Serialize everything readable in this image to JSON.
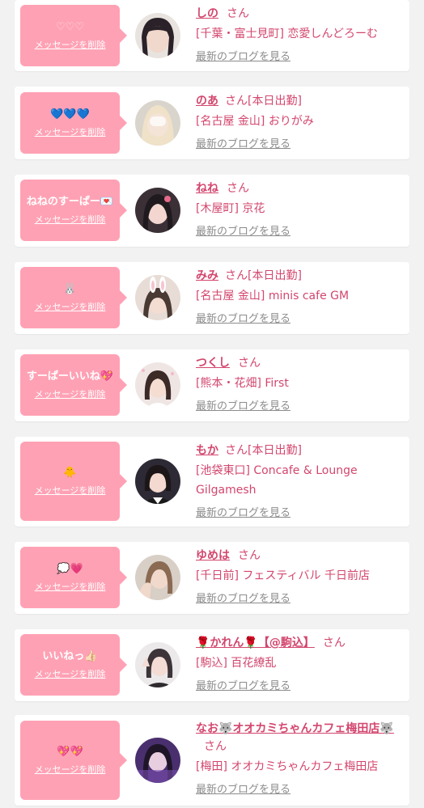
{
  "labels": {
    "delete": "メッセージを削除",
    "blog": "最新のブログを見る",
    "san": "さん"
  },
  "cards": [
    {
      "message": "♡♡♡",
      "name": "しの",
      "status": "",
      "shop": "[千葉・富士見町] 恋愛しんどろーむ",
      "avatar_icon": "profile-photo"
    },
    {
      "message": "💙💙💙",
      "name": "のあ",
      "status": "[本日出勤]",
      "shop": "[名古屋 金山] おりがみ",
      "avatar_icon": "profile-photo"
    },
    {
      "message": "ねねのすーぱー💌",
      "name": "ねね",
      "status": "",
      "shop": "[木屋町] 京花",
      "avatar_icon": "profile-photo"
    },
    {
      "message": "🐰",
      "name": "みみ",
      "status": "[本日出勤]",
      "shop": "[名古屋 金山] minis cafe GM",
      "avatar_icon": "profile-photo"
    },
    {
      "message": "すーぱーいいね💖",
      "name": "つくし",
      "status": "",
      "shop": "[熊本・花畑] First",
      "avatar_icon": "profile-photo"
    },
    {
      "message": "🐥",
      "name": "もか",
      "status": "[本日出勤]",
      "shop": "[池袋東口] Concafe & Lounge Gilgamesh",
      "avatar_icon": "profile-photo"
    },
    {
      "message": "💭💗",
      "name": "ゆめは",
      "status": "",
      "shop": "[千日前] フェスティバル 千日前店",
      "avatar_icon": "profile-photo"
    },
    {
      "message": "いいねっ👍🏻",
      "name": "🌹かれん🌹【@駒込】",
      "status": "",
      "shop": "[駒込] 百花繚乱",
      "avatar_icon": "profile-photo"
    },
    {
      "message": "💖💖",
      "name": "なお🐺オオカミちゃんカフェ梅田店🐺",
      "status": "",
      "shop": "[梅田] オオカミちゃんカフェ梅田店",
      "avatar_icon": "profile-photo"
    }
  ],
  "colors": {
    "bubble": "#ffa1b4",
    "name": "#d3466e",
    "blog": "#8c8c8c",
    "background": "#f2f2f2"
  }
}
